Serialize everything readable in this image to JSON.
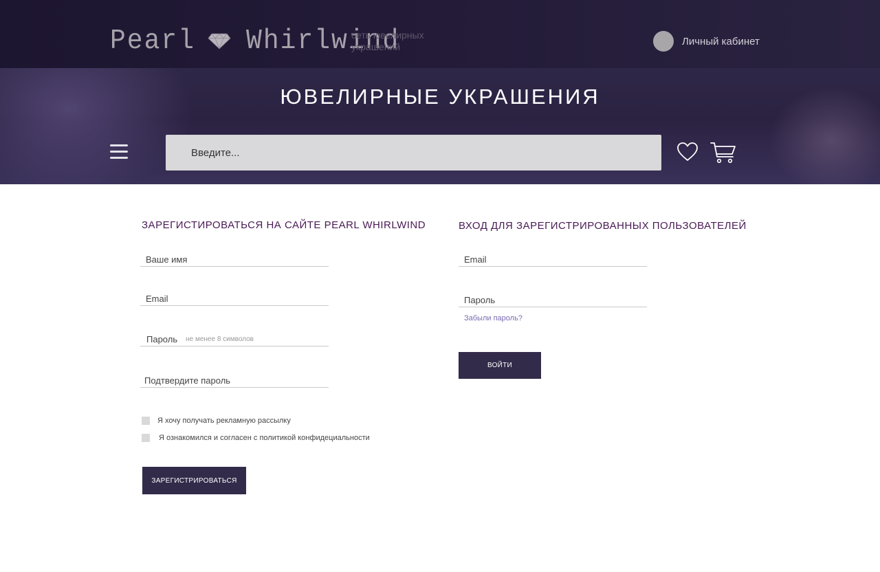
{
  "header": {
    "logo_word1": "Pearl",
    "logo_word2": "Whirlwind",
    "tagline": "сеть ювелирных украшений",
    "account_label": "Личный кабинет"
  },
  "hero": {
    "title": "ЮВЕЛИРНЫЕ УКРАШЕНИЯ",
    "search_placeholder": "Введите..."
  },
  "register": {
    "title": "ЗАРЕГИСТИРОВАТЬСЯ НА САЙТЕ PEARL WHIRLWIND",
    "name_label": "Ваше имя",
    "email_label": "Email",
    "password_label": "Пароль",
    "password_hint": "не менее 8 символов",
    "confirm_label": "Подтвердите пароль",
    "newsletter_label": "Я хочу получать рекламную рассылку",
    "privacy_label": "Я ознакомился и согласен с политикой конфидециальности",
    "submit_label": "ЗАРЕГИСТРИРОВАТЬСЯ"
  },
  "login": {
    "title": "ВХОД ДЛЯ ЗАРЕГИСТРИРОВАННЫХ ПОЛЬЗОВАТЕЛЕЙ",
    "email_label": "Email",
    "password_label": "Пароль",
    "forgot_label": "Забыли пароль?",
    "submit_label": "ВОЙТИ"
  },
  "colors": {
    "header_bg": "#1d1630",
    "accent_button": "#332b4a",
    "section_title": "#4a1a55",
    "link": "#7a6bb0"
  },
  "icons": [
    "diamond-icon",
    "menu-icon",
    "heart-icon",
    "cart-icon",
    "avatar"
  ]
}
